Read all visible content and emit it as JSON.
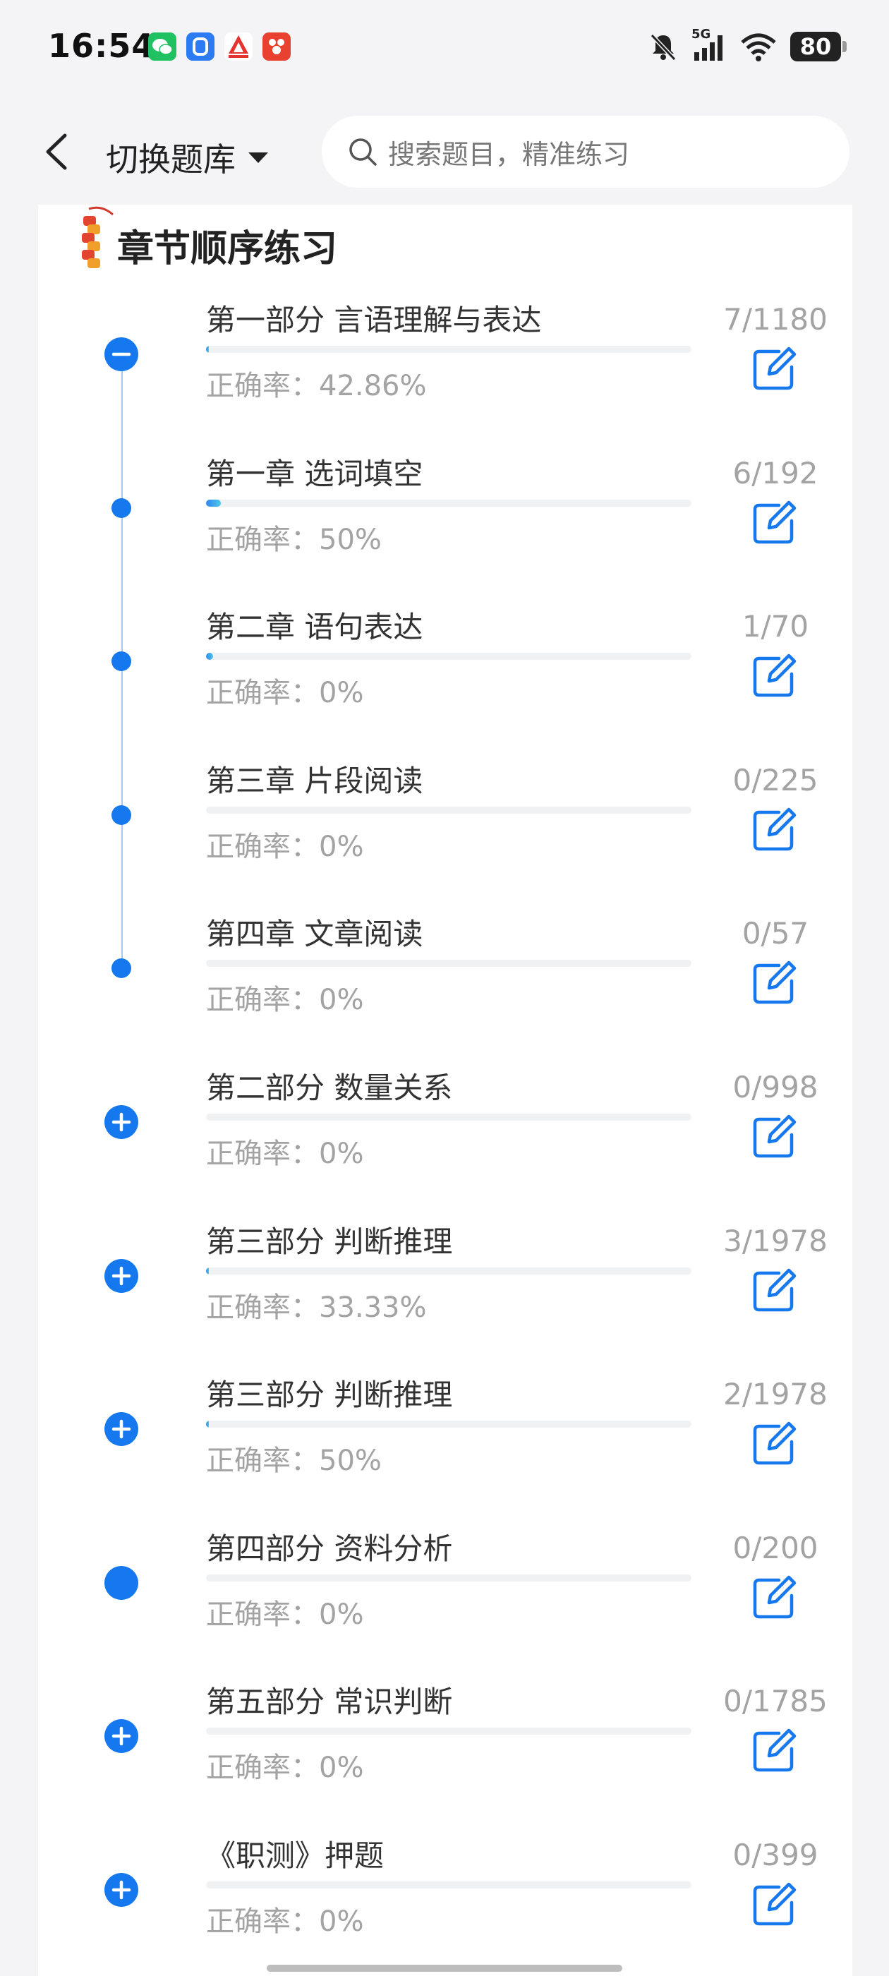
{
  "status_bar": {
    "time": "16:54",
    "battery": "80",
    "network": "5G",
    "icons": [
      "wechat-app-icon",
      "blue-app-icon",
      "red-app-icon",
      "red-square-app-icon",
      "bell-muted-icon",
      "signal-icon",
      "wifi-icon",
      "battery-icon"
    ]
  },
  "header": {
    "back_icon": "chevron-left-icon",
    "switch_label": "切换题库",
    "switch_icon": "caret-down-icon",
    "search_placeholder": "搜索题目，精准练习",
    "search_icon": "search-icon"
  },
  "section": {
    "title": "章节顺序练习",
    "title_icon": "firecracker-icon"
  },
  "colors": {
    "accent": "#1678ee",
    "progress_start": "#2e86f0",
    "progress_end": "#4ec8e8",
    "muted_text": "#a3a3a3"
  },
  "chapters": [
    {
      "title": "第一部分 言语理解与表达",
      "accuracy": "正确率：42.86%",
      "count": "7/1180",
      "progress": 0.006,
      "marker": "minus"
    },
    {
      "title": "第一章 选词填空",
      "accuracy": "正确率：50%",
      "count": "6/192",
      "progress": 0.031,
      "marker": "dot"
    },
    {
      "title": "第二章 语句表达",
      "accuracy": "正确率：0%",
      "count": "1/70",
      "progress": 0.014,
      "marker": "dot"
    },
    {
      "title": "第三章 片段阅读",
      "accuracy": "正确率：0%",
      "count": "0/225",
      "progress": 0,
      "marker": "dot"
    },
    {
      "title": "第四章 文章阅读",
      "accuracy": "正确率：0%",
      "count": "0/57",
      "progress": 0,
      "marker": "dot"
    },
    {
      "title": "第二部分 数量关系",
      "accuracy": "正确率：0%",
      "count": "0/998",
      "progress": 0,
      "marker": "plus"
    },
    {
      "title": "第三部分 判断推理",
      "accuracy": "正确率：33.33%",
      "count": "3/1978",
      "progress": 0.0015,
      "marker": "plus"
    },
    {
      "title": "第三部分 判断推理",
      "accuracy": "正确率：50%",
      "count": "2/1978",
      "progress": 0.001,
      "marker": "plus"
    },
    {
      "title": "第四部分 资料分析",
      "accuracy": "正确率：0%",
      "count": "0/200",
      "progress": 0,
      "marker": "filled"
    },
    {
      "title": "第五部分 常识判断",
      "accuracy": "正确率：0%",
      "count": "0/1785",
      "progress": 0,
      "marker": "plus"
    },
    {
      "title": "《职测》押题",
      "accuracy": "正确率：0%",
      "count": "0/399",
      "progress": 0,
      "marker": "plus"
    }
  ]
}
